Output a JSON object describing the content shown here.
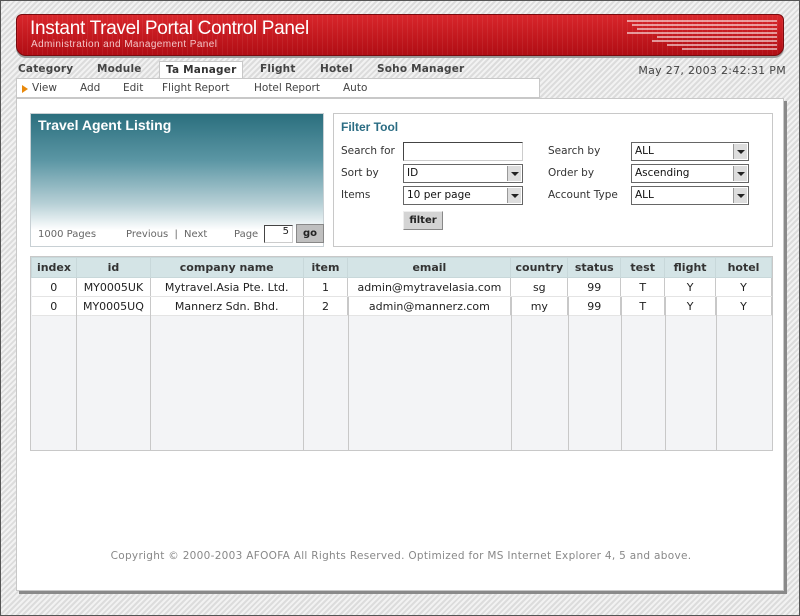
{
  "header": {
    "title": "Instant Travel Portal Control Panel",
    "subtitle": "Administration and Management Panel"
  },
  "tabs": [
    "Category",
    "Module",
    "Ta Manager",
    "Flight",
    "Hotel",
    "Soho Manager"
  ],
  "active_tab": "Ta Manager",
  "datetime": "May 27, 2003 2:42:31 PM",
  "subnav": [
    "View",
    "Add",
    "Edit",
    "Flight Report",
    "Hotel Report",
    "Auto"
  ],
  "listing": {
    "title": "Travel Agent Listing",
    "pages": "1000 Pages",
    "previous": "Previous",
    "separator": "|",
    "next": "Next",
    "page_label": "Page",
    "page_value": "5",
    "go_label": "go"
  },
  "filter": {
    "title": "Filter Tool",
    "search_for_label": "Search for",
    "search_for_value": "",
    "sort_by_label": "Sort by",
    "sort_by_value": "ID",
    "items_label": "Items",
    "items_value": "10 per page",
    "search_by_label": "Search by",
    "search_by_value": "ALL",
    "order_by_label": "Order by",
    "order_by_value": "Ascending",
    "account_type_label": "Account Type",
    "account_type_value": "ALL",
    "button": "filter"
  },
  "table": {
    "columns": [
      "index",
      "id",
      "company name",
      "item",
      "email",
      "country",
      "status",
      "test",
      "flight",
      "hotel"
    ],
    "rows": [
      [
        "0",
        "MY0005UK",
        "Mytravel.Asia Pte. Ltd.",
        "1",
        "admin@mytravelasia.com",
        "sg",
        "99",
        "T",
        "Y",
        "Y"
      ],
      [
        "0",
        "MY0005UQ",
        "Mannerz Sdn. Bhd.",
        "2",
        "admin@mannerz.com",
        "my",
        "99",
        "T",
        "Y",
        "Y"
      ]
    ]
  },
  "footer": {
    "copyright": "Copyright © 2000-2003 AFOOFA All Rights Reserved. Optimized for MS Internet Explorer 4, 5 and above."
  }
}
